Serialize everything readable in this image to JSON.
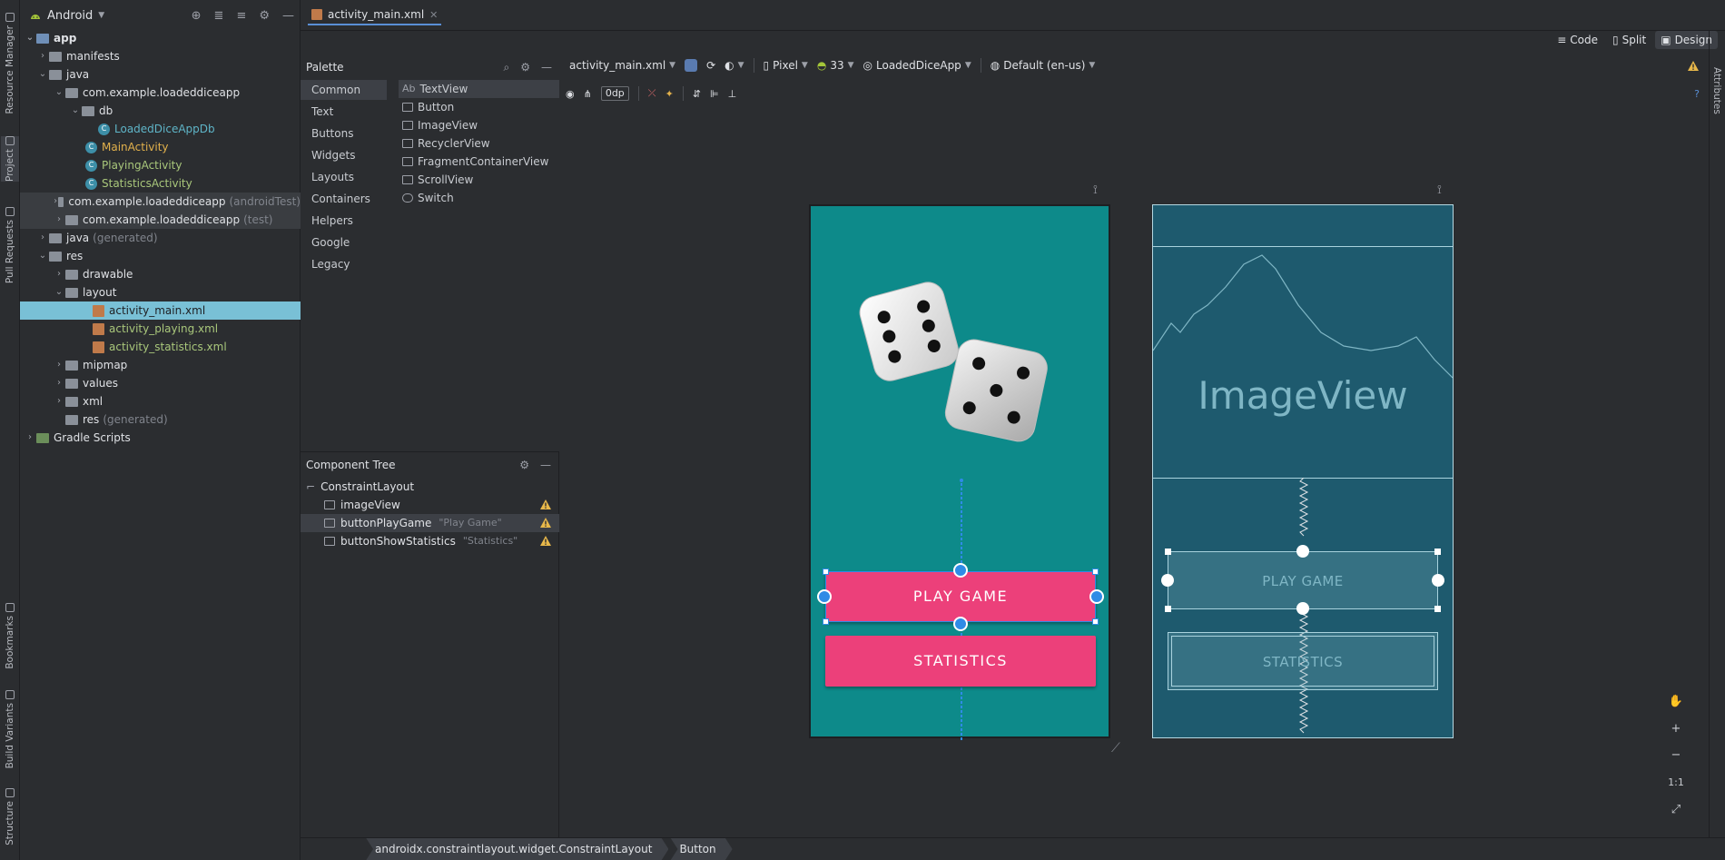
{
  "left_strip": {
    "tabs": [
      "Resource Manager",
      "Project",
      "Pull Requests",
      "Bookmarks",
      "Build Variants",
      "Structure"
    ]
  },
  "project": {
    "view_selector": "Android",
    "tree": [
      {
        "label": "app",
        "muted": ""
      },
      {
        "label": "manifests",
        "muted": ""
      },
      {
        "label": "java",
        "muted": ""
      },
      {
        "label": "com.example.loadeddiceapp",
        "muted": ""
      },
      {
        "label": "db",
        "muted": ""
      },
      {
        "label": "LoadedDiceAppDb",
        "muted": ""
      },
      {
        "label": "MainActivity",
        "muted": ""
      },
      {
        "label": "PlayingActivity",
        "muted": ""
      },
      {
        "label": "StatisticsActivity",
        "muted": ""
      },
      {
        "label": "com.example.loadeddiceapp",
        "muted": "(androidTest)"
      },
      {
        "label": "com.example.loadeddiceapp",
        "muted": "(test)"
      },
      {
        "label": "java",
        "muted": "(generated)"
      },
      {
        "label": "res",
        "muted": ""
      },
      {
        "label": "drawable",
        "muted": ""
      },
      {
        "label": "layout",
        "muted": ""
      },
      {
        "label": "activity_main.xml",
        "muted": ""
      },
      {
        "label": "activity_playing.xml",
        "muted": ""
      },
      {
        "label": "activity_statistics.xml",
        "muted": ""
      },
      {
        "label": "mipmap",
        "muted": ""
      },
      {
        "label": "values",
        "muted": ""
      },
      {
        "label": "xml",
        "muted": ""
      },
      {
        "label": "res",
        "muted": "(generated)"
      },
      {
        "label": "Gradle Scripts",
        "muted": ""
      }
    ]
  },
  "editor": {
    "tab_label": "activity_main.xml",
    "view_modes": [
      "Code",
      "Split",
      "Design"
    ]
  },
  "palette": {
    "title": "Palette",
    "categories": [
      "Common",
      "Text",
      "Buttons",
      "Widgets",
      "Layouts",
      "Containers",
      "Helpers",
      "Google",
      "Legacy"
    ],
    "items": [
      "TextView",
      "Button",
      "ImageView",
      "RecyclerView",
      "FragmentContainerView",
      "ScrollView",
      "Switch"
    ],
    "textview_prefix": "Ab"
  },
  "component_tree": {
    "title": "Component Tree",
    "rows": [
      {
        "label": "ConstraintLayout",
        "hint": ""
      },
      {
        "label": "imageView",
        "hint": ""
      },
      {
        "label": "buttonPlayGame",
        "hint": "\"Play Game\""
      },
      {
        "label": "buttonShowStatistics",
        "hint": "\"Statistics\""
      }
    ]
  },
  "toolbar": {
    "file": "activity_main.xml",
    "device": "Pixel",
    "api": "33",
    "theme": "LoadedDiceApp",
    "locale": "Default (en-us)",
    "margin": "0dp"
  },
  "design": {
    "play_button": "PLAY GAME",
    "stats_button": "STATISTICS"
  },
  "blueprint": {
    "image_label": "ImageView",
    "play_button": "PLAY GAME",
    "stats_button": "STATISTICS"
  },
  "right_strip": {
    "label": "Attributes"
  },
  "zoom": {
    "reset": "1:1"
  },
  "statusbar": {
    "crumbs": [
      "androidx.constraintlayout.widget.ConstraintLayout",
      "Button"
    ]
  },
  "colors": {
    "teal_bg": "#0d8a8a",
    "button_pink": "#ec407a",
    "blueprint_bg": "#1e5a6e",
    "selection": "#79c0d6"
  }
}
